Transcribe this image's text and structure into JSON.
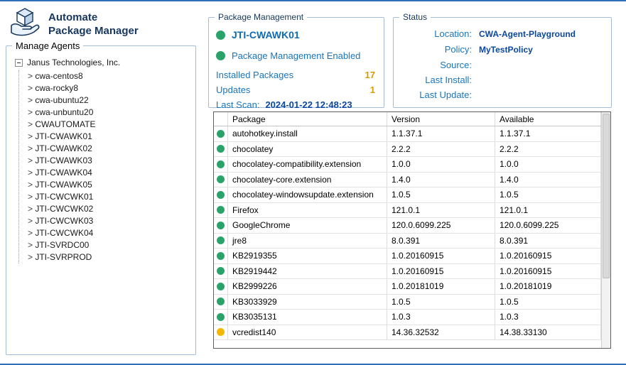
{
  "app": {
    "title_line1": "Automate",
    "title_line2": "Package Manager"
  },
  "sidebar": {
    "title": "Manage Agents",
    "root": "Janus Technologies, Inc.",
    "agents": [
      "cwa-centos8",
      "cwa-rocky8",
      "cwa-ubuntu22",
      "cwa-unbuntu20",
      "CWAUTOMATE",
      "JTI-CWAWK01",
      "JTI-CWAWK02",
      "JTI-CWAWK03",
      "JTI-CWAWK04",
      "JTI-CWAWK05",
      "JTI-CWCWK01",
      "JTI-CWCWK02",
      "JTI-CWCWK03",
      "JTI-CWCWK04",
      "JTI-SVRDC00",
      "JTI-SVRPROD"
    ]
  },
  "package_management": {
    "title": "Package Management",
    "agent_name": "JTI-CWAWK01",
    "enabled_text": "Package Management Enabled",
    "installed_label": "Installed Packages",
    "installed_value": "17",
    "updates_label": "Updates",
    "updates_value": "1",
    "last_scan_label": "Last Scan:",
    "last_scan_value": "2024-01-22 12:48:23"
  },
  "status_panel": {
    "title": "Status",
    "fields": [
      {
        "label": "Location:",
        "value": "CWA-Agent-Playground"
      },
      {
        "label": "Policy:",
        "value": "MyTestPolicy"
      },
      {
        "label": "Source:",
        "value": ""
      },
      {
        "label": "Last Install:",
        "value": ""
      },
      {
        "label": "Last Update:",
        "value": ""
      }
    ]
  },
  "table": {
    "columns": [
      "Package",
      "Version",
      "Available"
    ],
    "rows": [
      {
        "status": "green",
        "package": "autohotkey.install",
        "version": "1.1.37.1",
        "available": "1.1.37.1"
      },
      {
        "status": "green",
        "package": "chocolatey",
        "version": "2.2.2",
        "available": "2.2.2"
      },
      {
        "status": "green",
        "package": "chocolatey-compatibility.extension",
        "version": "1.0.0",
        "available": "1.0.0"
      },
      {
        "status": "green",
        "package": "chocolatey-core.extension",
        "version": "1.4.0",
        "available": "1.4.0"
      },
      {
        "status": "green",
        "package": "chocolatey-windowsupdate.extension",
        "version": "1.0.5",
        "available": "1.0.5"
      },
      {
        "status": "green",
        "package": "Firefox",
        "version": "121.0.1",
        "available": "121.0.1"
      },
      {
        "status": "green",
        "package": "GoogleChrome",
        "version": "120.0.6099.225",
        "available": "120.0.6099.225"
      },
      {
        "status": "green",
        "package": "jre8",
        "version": "8.0.391",
        "available": "8.0.391"
      },
      {
        "status": "green",
        "package": "KB2919355",
        "version": "1.0.20160915",
        "available": "1.0.20160915"
      },
      {
        "status": "green",
        "package": "KB2919442",
        "version": "1.0.20160915",
        "available": "1.0.20160915"
      },
      {
        "status": "green",
        "package": "KB2999226",
        "version": "1.0.20181019",
        "available": "1.0.20181019"
      },
      {
        "status": "green",
        "package": "KB3033929",
        "version": "1.0.5",
        "available": "1.0.5"
      },
      {
        "status": "green",
        "package": "KB3035131",
        "version": "1.0.3",
        "available": "1.0.3"
      },
      {
        "status": "yellow",
        "package": "vcredist140",
        "version": "14.36.32532",
        "available": "14.38.33130"
      }
    ]
  },
  "colors": {
    "accent_blue": "#1b75bc",
    "value_navy": "#0a47a0",
    "ok_green": "#2aa36a",
    "warn_yellow": "#f5b800",
    "count_orange": "#d89b00",
    "window_border": "#2f6fb7"
  }
}
